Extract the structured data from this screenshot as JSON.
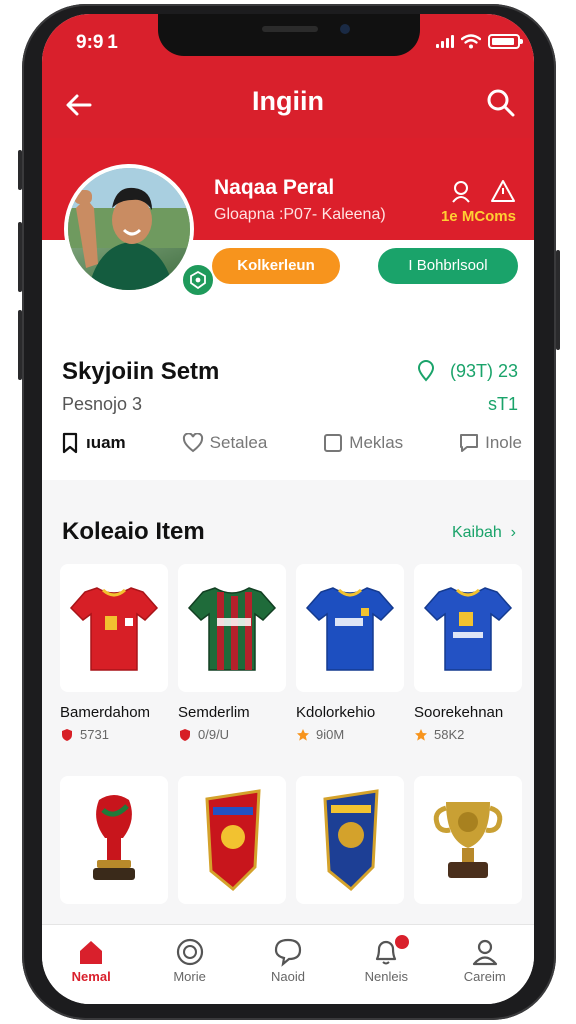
{
  "status": {
    "time": "9:9 1"
  },
  "header": {
    "title": "Ingiin"
  },
  "profile": {
    "name": "Naqaa Peral",
    "subtitle": "Gloapna :P07- Kaleena)",
    "stat": "1e MComs",
    "primary_button": "Kolkerleun",
    "secondary_button": "I Bohbrlsool"
  },
  "section": {
    "title": "Skyjoiin Setm",
    "subtitle": "Pesnojo 3",
    "right_value": "(93T) 23",
    "right_value2": "sT1"
  },
  "tabs": [
    {
      "label": "ıuam",
      "icon": "bookmark-icon"
    },
    {
      "label": "Setalea",
      "icon": "heart-icon"
    },
    {
      "label": "Meklas",
      "icon": "square-icon"
    },
    {
      "label": "Inole",
      "icon": "chat-icon"
    }
  ],
  "collection": {
    "title": "Koleaio Item",
    "see_all": "Kaibah",
    "items": [
      {
        "name": "Bamerdahom",
        "price": "5731"
      },
      {
        "name": "Semderlim",
        "price": "0/9/U"
      },
      {
        "name": "Kdolorkehio",
        "price": "9i0M"
      },
      {
        "name": "Soorekehnan",
        "price": "58K2"
      }
    ]
  },
  "bottom_nav": [
    {
      "label": "Nemal",
      "icon": "home-icon"
    },
    {
      "label": "Morie",
      "icon": "circle-icon"
    },
    {
      "label": "Naoid",
      "icon": "chat-bubble-icon"
    },
    {
      "label": "Nenleis",
      "icon": "bell-icon"
    },
    {
      "label": "Careim",
      "icon": "user-icon"
    }
  ],
  "colors": {
    "primary": "#d9202c",
    "accent_green": "#1aa36a",
    "accent_orange": "#f7941d"
  }
}
